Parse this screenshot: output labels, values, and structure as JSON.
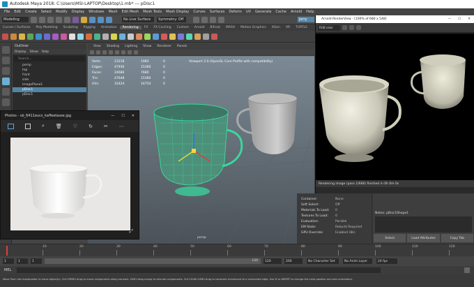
{
  "app": {
    "title": "Autodesk Maya 2018: C:\\Users\\MSI-LAPTOP\\Desktop\\1.mb*   ---   pDisc1"
  },
  "menubar": {
    "items": [
      "File",
      "Edit",
      "Create",
      "Select",
      "Modify",
      "Display",
      "Windows",
      "Mesh",
      "Edit Mesh",
      "Mesh Tools",
      "Mesh Display",
      "Curves",
      "Surfaces",
      "Deform",
      "UV",
      "Generate",
      "Cache",
      "Arnold",
      "Help"
    ]
  },
  "statusline": {
    "mode": "Modeling",
    "live_surface": "No Live Surface",
    "symmetry": "Symmetry: Off",
    "user": "Jerry"
  },
  "shelf_tabs": [
    "Curves / Surfaces",
    "Poly Modeling",
    "Sculpting",
    "Rigging",
    "Animation",
    "Rendering",
    "FX",
    "FX Caching",
    "Custom",
    "Arnold",
    "Bifrost",
    "MASH",
    "Motion Graphics",
    "XGen",
    "VR",
    "TURTLE"
  ],
  "outliner": {
    "title": "Outliner",
    "menu": [
      "Display",
      "Show",
      "Help"
    ],
    "search_placeholder": "Search...",
    "items": [
      "persp",
      "top",
      "front",
      "side",
      "imagePlane1",
      "pDisc1",
      "pDisc1"
    ]
  },
  "viewport": {
    "menu": [
      "View",
      "Shading",
      "Lighting",
      "Show",
      "Renderer",
      "Panels"
    ],
    "hud_labels": [
      "Verts:",
      "Edges:",
      "Faces:",
      "Tris:",
      "UVs:"
    ],
    "hud_col1": [
      "23218",
      "47936",
      "24686",
      "47648",
      "32424"
    ],
    "hud_col2": [
      "1983",
      "15360",
      "7680",
      "15360",
      "16754"
    ],
    "hud_col3": [
      "0",
      "0",
      "0",
      "0",
      "0"
    ],
    "viewport_banner": "Viewport 2.0 (OpenGL Core Profile with compatibility)",
    "camera_label": "persp"
  },
  "render_view": {
    "title": "Arnold RenderView - [100% of 680 x 548]",
    "channel": "RGB color",
    "status": "Rendering image (pass 1/666) finished in 0h 0m 0s"
  },
  "photos": {
    "title": "Photos - sb_6411eucs_kaffeetasse.jpg"
  },
  "attributes": {
    "rows": [
      {
        "k": "Container:",
        "v": "None"
      },
      {
        "k": "Soft Select:",
        "v": "Off"
      },
      {
        "k": "Materials To Load:",
        "v": "0"
      },
      {
        "k": "Textures To Load:",
        "v": "0"
      },
      {
        "k": "Evaluation:",
        "v": "Parallel"
      },
      {
        "k": "EM State:",
        "v": "Rebuild Required"
      },
      {
        "k": "GPU Override:",
        "v": "Enabled (8k)"
      }
    ]
  },
  "notes": {
    "label": "Notes: pDisc1Shape1",
    "buttons": [
      "Select",
      "Load Attributes",
      "Copy Tab"
    ]
  },
  "timeline": {
    "ticks": [
      "10",
      "20",
      "30",
      "40",
      "50",
      "60",
      "70",
      "80",
      "90",
      "100",
      "110",
      "120"
    ],
    "start": "1",
    "start2": "1",
    "current": "1",
    "end_inner": "120",
    "end": "120",
    "end2": "200",
    "character_set": "No Character Set",
    "anim_layer": "No Anim Layer",
    "fps": "24 fps"
  },
  "mel": {
    "label": "MEL"
  },
  "helpline": {
    "text": "Move Tool: Use manipulator to move object(s). Ctrl+MMB+drag to move components along normals. Shift+drag manip to extrude components. Ctrl+Shift+LMB+drag to constrain movement to a connected edge. Use D or INSERT to change the pivot position and axis orientation."
  },
  "colors": {
    "accent": "#5285a6",
    "viewport_bg": "#6e7c86",
    "wire": "#3ad79d"
  }
}
